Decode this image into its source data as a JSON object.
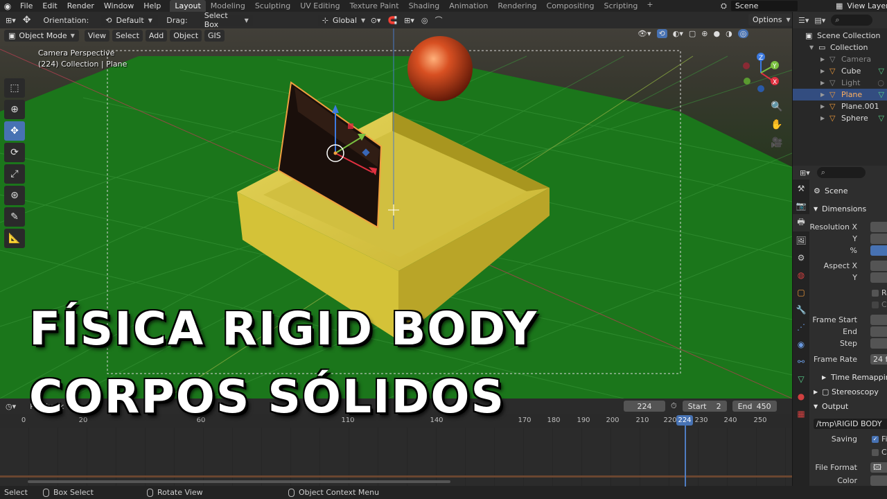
{
  "topbar": {
    "menus": [
      "File",
      "Edit",
      "Render",
      "Window",
      "Help"
    ],
    "workspaces": [
      "Layout",
      "Modeling",
      "Sculpting",
      "UV Editing",
      "Texture Paint",
      "Shading",
      "Animation",
      "Rendering",
      "Compositing",
      "Scripting"
    ],
    "active_workspace": "Layout",
    "scene_name": "Scene",
    "view_layer": "View Layer"
  },
  "viewport_header": {
    "orientation_label": "Orientation:",
    "orientation_value": "Default",
    "drag_label": "Drag:",
    "drag_value": "Select Box",
    "transform_orientation": "Global",
    "options_label": "Options"
  },
  "viewport_menu": {
    "mode": "Object Mode",
    "items": [
      "View",
      "Select",
      "Add",
      "Object",
      "GIS"
    ]
  },
  "viewport": {
    "camera_label": "Camera Perspective",
    "collection_label": "(224) Collection | Plane"
  },
  "overlay_title": {
    "line1": "FÍSICA RIGID BODY",
    "line2": "CORPOS SÓLIDOS"
  },
  "timeline": {
    "playback_label": "Playback",
    "current_frame": "224",
    "start_label": "Start",
    "start_value": "2",
    "end_label": "End",
    "end_value": "450",
    "ruler_ticks": [
      "0",
      "20",
      "60",
      "110",
      "140",
      "170",
      "180",
      "190",
      "200",
      "210",
      "220",
      "230",
      "240",
      "250"
    ],
    "playhead_frame": "224"
  },
  "status_bar": {
    "select": "Select",
    "box_select": "Box Select",
    "rotate_view": "Rotate View",
    "context_menu": "Object Context Menu"
  },
  "outliner": {
    "scene_collection": "Scene Collection",
    "collection": "Collection",
    "objects": [
      {
        "name": "Camera",
        "dim": true
      },
      {
        "name": "Cube",
        "dim": false
      },
      {
        "name": "Light",
        "dim": true
      },
      {
        "name": "Plane",
        "dim": false,
        "selected": true
      },
      {
        "name": "Plane.001",
        "dim": false
      },
      {
        "name": "Sphere",
        "dim": false
      }
    ]
  },
  "properties": {
    "context": "Scene",
    "dimensions": "Dimensions",
    "resolution_x": "Resolution X",
    "y": "Y",
    "percent": "%",
    "aspect_x": "Aspect X",
    "aspect_y": "Y",
    "render_region": "Re",
    "crop": "Cr",
    "frame_start": "Frame Start",
    "frame_end": "End",
    "frame_step": "Step",
    "frame_rate": "Frame Rate",
    "frame_rate_value": "24 f",
    "time_remapping": "Time Remapping",
    "stereoscopy": "Stereoscopy",
    "output": "Output",
    "output_path": "/tmp\\RIGID BODY",
    "saving": "Saving",
    "saving_file": "Fil",
    "saving_cache": "Ca",
    "file_format": "File Format",
    "color": "Color"
  },
  "colors": {
    "accent": "#4772b3",
    "floor": "#1a7a1a",
    "box": "#d8c63c",
    "sphere": "#c8401c"
  }
}
